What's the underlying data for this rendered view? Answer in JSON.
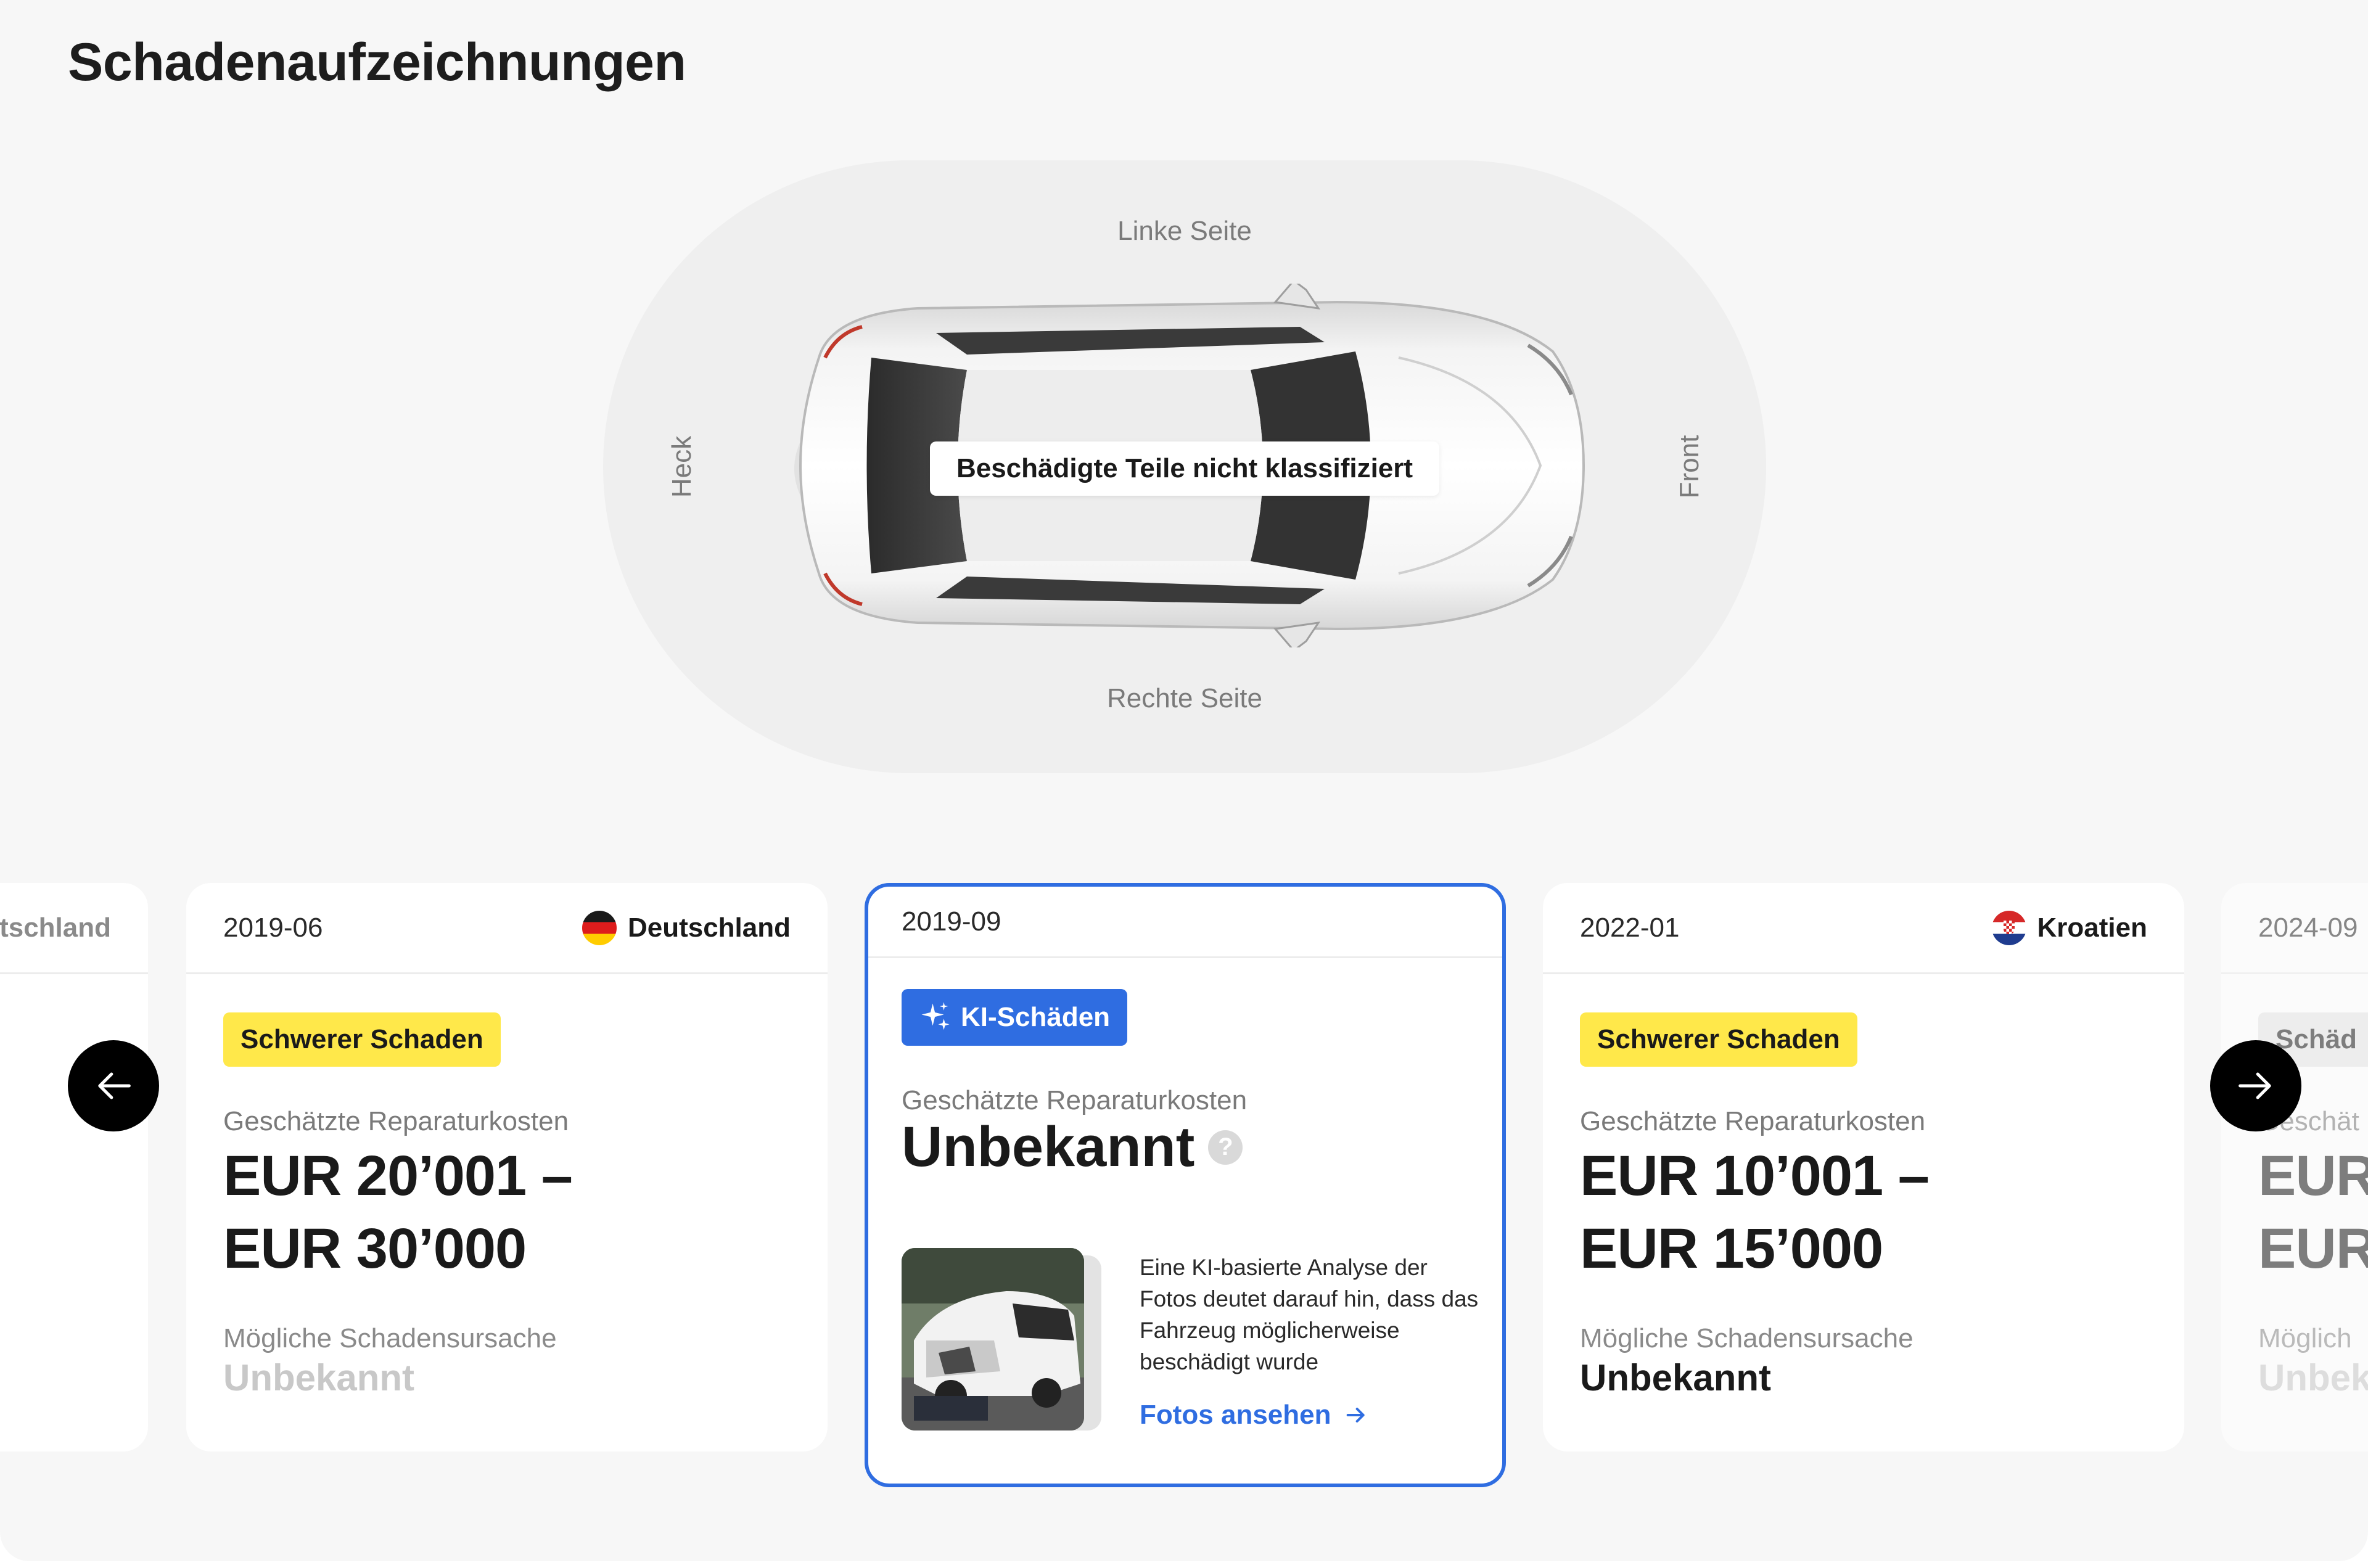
{
  "page": {
    "title": "Schadenaufzeichnungen"
  },
  "diagram": {
    "left_side": "Linke Seite",
    "right_side": "Rechte Seite",
    "rear": "Heck",
    "front": "Front",
    "status": "Beschädigte Teile nicht klassifiziert"
  },
  "cards": [
    {
      "date": "",
      "country": "Deutschland",
      "badge": "",
      "cost_label": "",
      "cost_line1": "",
      "cost_line2": "",
      "cause_label": "",
      "cause_value": ""
    },
    {
      "date": "2019-06",
      "country": "Deutschland",
      "badge": "Schwerer Schaden",
      "cost_label": "Geschätzte Reparaturkosten",
      "cost_line1": "EUR 20’001 –",
      "cost_line2": "EUR 30’000",
      "cause_label": "Mögliche Schadensursache",
      "cause_value": "Unbekannt"
    },
    {
      "date": "2019-09",
      "badge": "KI-Schäden",
      "cost_label": "Geschätzte Reparaturkosten",
      "cost_value": "Unbekannt",
      "help": "?",
      "description": "Eine KI-basierte Analyse der Fotos deutet darauf hin, dass das Fahrzeug möglicherweise beschädigt wurde",
      "link": "Fotos ansehen"
    },
    {
      "date": "2022-01",
      "country": "Kroatien",
      "badge": "Schwerer Schaden",
      "cost_label": "Geschätzte Reparaturkosten",
      "cost_line1": "EUR 10’001 –",
      "cost_line2": "EUR 15’000",
      "cause_label": "Mögliche Schadensursache",
      "cause_value": "Unbekannt"
    },
    {
      "date": "2024-09",
      "badge": "Schäd",
      "cost_label": "Geschät",
      "cost_line1": "EUR",
      "cost_line2": "EUR",
      "cause_label": "Möglich",
      "cause_value": "Unbek"
    }
  ],
  "nav": {
    "prev": "←",
    "next": "→"
  },
  "colors": {
    "accent": "#2f6de1",
    "badge_yellow": "#ffe84a",
    "nav_bg": "#000000"
  },
  "icons": {
    "ki": "sparkles-icon",
    "help": "question-icon",
    "link": "arrow-right-icon"
  }
}
